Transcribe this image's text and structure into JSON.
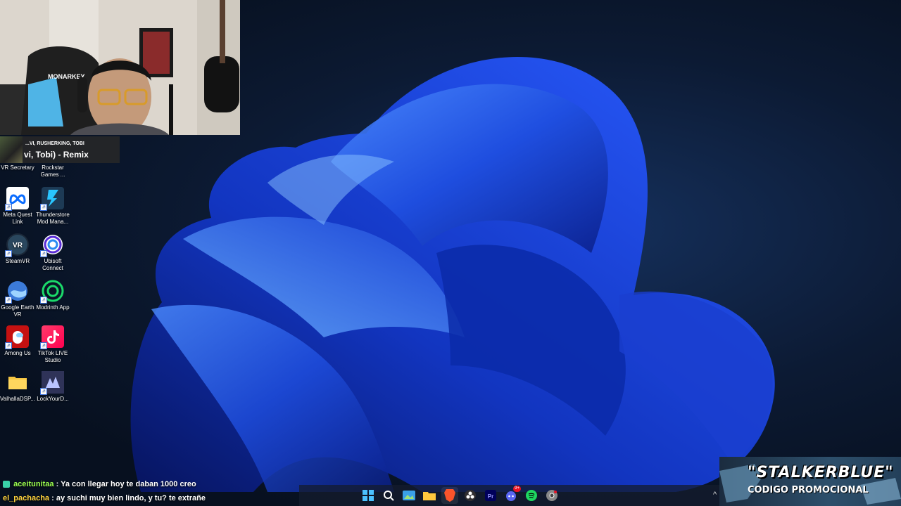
{
  "now_playing": {
    "artist": "...VI, RUSHERKING, TOBI",
    "track": "vi, Tobi) - Remix"
  },
  "desktop_icons": [
    {
      "label": "VR Secretary",
      "icon": "vr-secretary-icon"
    },
    {
      "label": "Rockstar Games ...",
      "icon": "rockstar-games-icon"
    },
    {
      "label": "Meta Quest Link",
      "icon": "meta-quest-icon"
    },
    {
      "label": "Thunderstore Mod Mana...",
      "icon": "thunderstore-icon"
    },
    {
      "label": "SteamVR",
      "icon": "steamvr-icon"
    },
    {
      "label": "Ubisoft Connect",
      "icon": "ubisoft-icon"
    },
    {
      "label": "Google Earth VR",
      "icon": "google-earth-icon"
    },
    {
      "label": "Modrinth App",
      "icon": "modrinth-icon"
    },
    {
      "label": "Among Us",
      "icon": "among-us-icon"
    },
    {
      "label": "TikTok LIVE Studio",
      "icon": "tiktok-live-icon"
    },
    {
      "label": "ValhallaDSP...",
      "icon": "folder-icon"
    },
    {
      "label": "LockYourD...",
      "icon": "lockyourd-icon"
    }
  ],
  "chat": [
    {
      "user": "aceitunitaa",
      "message": ": Ya con llegar hoy te daban 1000 creo"
    },
    {
      "user": "el_pachacha",
      "message": ": ay suchi muy bien lindo, y tu? te extrañe"
    }
  ],
  "taskbar": {
    "items": [
      "start-icon",
      "search-icon",
      "widgets-icon",
      "file-explorer-icon",
      "brave-browser-icon",
      "obs-icon",
      "premiere-icon",
      "discord-icon",
      "spotify-icon",
      "chrome-icon"
    ],
    "discord_badge": "9+"
  },
  "promo": {
    "name": "\"STALKERBLUE\"",
    "subtitle": "CODIGO PROMOCIONAL"
  }
}
